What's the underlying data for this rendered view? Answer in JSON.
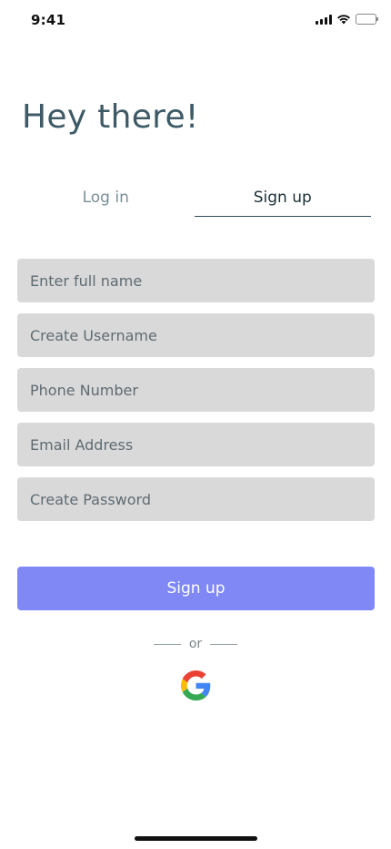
{
  "status_bar": {
    "time": "9:41",
    "icons": [
      "cellular-signal-icon",
      "wifi-icon",
      "battery-icon"
    ]
  },
  "header": {
    "title": "Hey there!"
  },
  "tabs": [
    {
      "label": "Log in",
      "active": false
    },
    {
      "label": "Sign up",
      "active": true
    }
  ],
  "form": {
    "full_name": {
      "placeholder": "Enter full name",
      "value": ""
    },
    "username": {
      "placeholder": "Create Username",
      "value": ""
    },
    "phone": {
      "placeholder": "Phone Number",
      "value": ""
    },
    "email": {
      "placeholder": "Email Address",
      "value": ""
    },
    "password": {
      "placeholder": "Create Password",
      "value": ""
    },
    "submit_label": "Sign up"
  },
  "divider": {
    "text": "or"
  },
  "social": {
    "google_icon": "google-g-icon"
  },
  "colors": {
    "title": "#3d5a66",
    "field_background": "#d9d9d9",
    "primary_button": "#7f88f5",
    "active_tab_underline": "#2f4d5a"
  }
}
